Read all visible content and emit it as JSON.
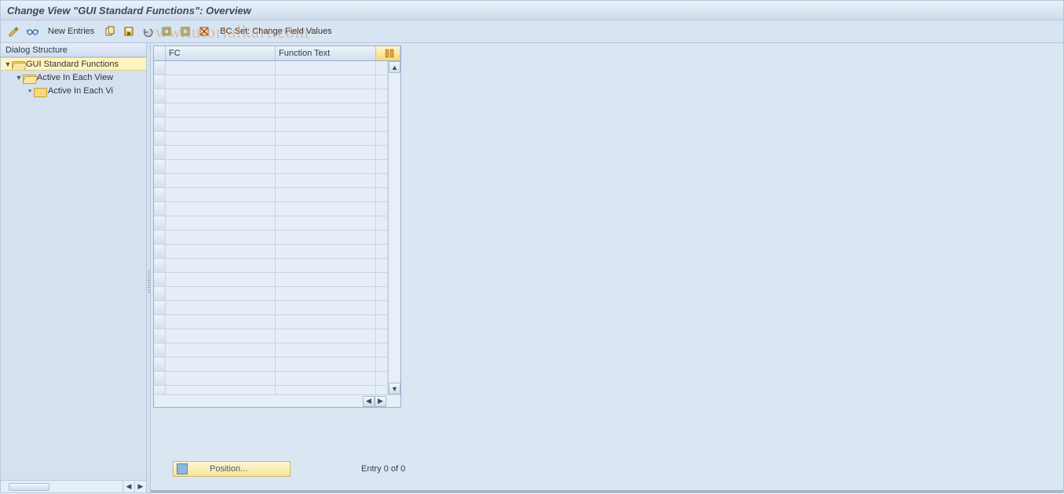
{
  "title": "Change View \"GUI Standard Functions\": Overview",
  "watermark": "www.tutorialkart.com",
  "toolbar": {
    "new_entries": "New Entries",
    "bc_set": "BC Set: Change Field Values",
    "icons": {
      "pencil": "pencil-display-change-icon",
      "glasses": "glasses-detail-icon",
      "copy": "copy-icon",
      "save": "save-icon",
      "undo": "undo-icon",
      "select_all": "select-all-icon",
      "select_block": "select-block-icon",
      "deselect": "deselect-icon"
    }
  },
  "tree": {
    "header": "Dialog Structure",
    "nodes": [
      {
        "label": "GUI Standard Functions",
        "open": true,
        "level": 0,
        "selected": true
      },
      {
        "label": "Active In Each View",
        "open": true,
        "level": 1,
        "selected": false
      },
      {
        "label": "Active In Each Vi",
        "open": false,
        "level": 2,
        "selected": false,
        "leaf": true
      }
    ]
  },
  "grid": {
    "columns": {
      "c1": "FC",
      "c2": "Function Text"
    },
    "rows_count": 24
  },
  "footer": {
    "position_label": "Position...",
    "entry_text": "Entry 0 of 0"
  }
}
